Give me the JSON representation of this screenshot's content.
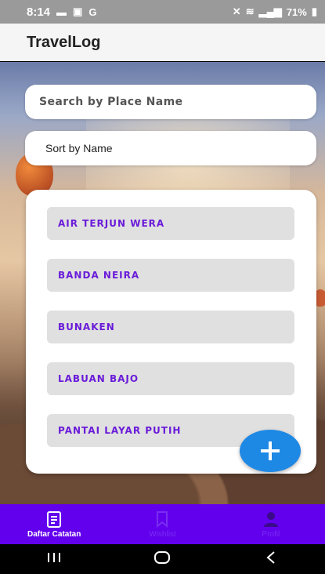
{
  "status_bar": {
    "time": "8:14",
    "battery": "71%",
    "left_icons": [
      "message-icon",
      "gallery-icon",
      "google-icon"
    ],
    "right_icons": [
      "mute-icon",
      "volte-icon",
      "signal-icon",
      "battery-icon"
    ]
  },
  "app": {
    "title": "TravelLog"
  },
  "search": {
    "placeholder": "Search by Place Name"
  },
  "sort": {
    "value": "Sort by Name"
  },
  "places": [
    "AIR TERJUN WERA",
    "BANDA NEIRA",
    "BUNAKEN",
    "LABUAN BAJO",
    "PANTAI LAYAR PUTIH"
  ],
  "fab": {
    "icon": "plus-icon"
  },
  "bottom_nav": [
    {
      "label": "Daftar Catatan",
      "icon": "notes-icon",
      "active": true
    },
    {
      "label": "Wishlist",
      "icon": "bookmark-icon",
      "active": false
    },
    {
      "label": "Profil",
      "icon": "person-icon",
      "active": false
    }
  ],
  "system_nav": [
    "recents-icon",
    "home-icon",
    "back-icon"
  ],
  "colors": {
    "accent": "#6200ee",
    "item_text": "#6a1bd9",
    "fab": "#1e88e5",
    "item_bg": "#e0e0e0"
  }
}
